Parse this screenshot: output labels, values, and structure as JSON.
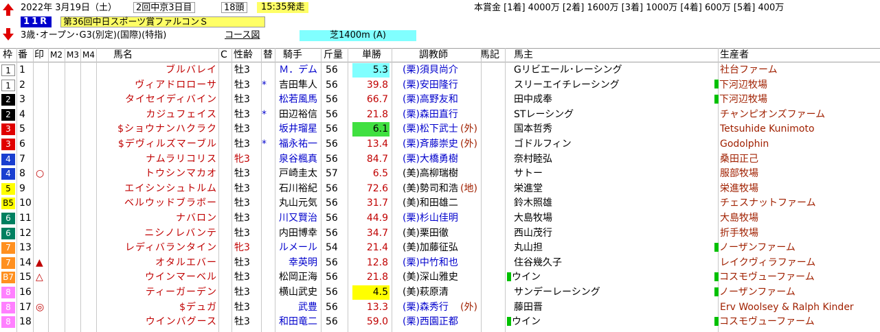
{
  "header": {
    "date": "2022年 3月19日（土）",
    "meeting": "2回中京3日目",
    "heads": "18頭",
    "post_time": "15:35発走",
    "prize": "本賞金 [1着] 4000万 [2着] 1600万 [3着] 1000万 [4着] 600万 [5着] 400万",
    "race_no": "11R",
    "race_name": "第36回中日スポーツ賞ファルコンＳ",
    "conditions": "3歳･オープン･G3(別定)(国際)(特指)",
    "course_link": "コース図",
    "course": "芝1400m (A)"
  },
  "columns": {
    "waku": "枠",
    "ban": "番",
    "mark": "印",
    "m2": "M2",
    "m3": "M3",
    "m4": "M4",
    "name": "馬名",
    "c": "C",
    "sexage": "性齢",
    "change": "替",
    "jockey": "騎手",
    "weight": "斤量",
    "odds": "単勝",
    "trainer": "調教師",
    "uma_ki": "馬記",
    "owner": "馬主",
    "breeder": "生産者"
  },
  "colors": {
    "jockey_blue": "#0000cc",
    "name_red": "#c00000",
    "breeder_brown": "#a02000"
  },
  "horses": [
    {
      "waku": "1",
      "ban": "1",
      "mark": "",
      "name": "ブルバレイ",
      "sexage": "牡3",
      "change": "",
      "jockey": "Ｍ．デム",
      "weight": "56",
      "odds": "5.3",
      "trainer": "(栗)須貝尚介",
      "owner": "Gリビエール･レーシング",
      "breeder": "社台ファーム"
    },
    {
      "waku": "1",
      "ban": "2",
      "mark": "",
      "name": "ヴィアドロローサ",
      "sexage": "牡3",
      "change": "*",
      "jockey": "吉田隼人",
      "weight": "56",
      "odds": "39.8",
      "trainer": "(栗)安田隆行",
      "owner": "スリーエイチレーシング",
      "breeder": "下河辺牧場"
    },
    {
      "waku": "2",
      "ban": "3",
      "mark": "",
      "name": "タイセイディバイン",
      "sexage": "牡3",
      "change": "",
      "jockey": "松若風馬",
      "weight": "56",
      "odds": "66.7",
      "trainer": "(栗)高野友和",
      "owner": "田中成奉",
      "breeder": "下河辺牧場"
    },
    {
      "waku": "2",
      "ban": "4",
      "mark": "",
      "name": "カジュフェイス",
      "sexage": "牡3",
      "change": "*",
      "jockey": "田辺裕信",
      "weight": "56",
      "odds": "21.8",
      "trainer": "(栗)森田直行",
      "owner": "STレーシング",
      "breeder": "チャンピオンズファーム"
    },
    {
      "waku": "3",
      "ban": "5",
      "mark": "",
      "name": "$ショウナンハクラク",
      "sexage": "牡3",
      "change": "",
      "jockey": "坂井瑠星",
      "weight": "56",
      "odds": "6.1",
      "trainer": "(栗)松下武士",
      "trainer_note": "(外)",
      "owner": "国本哲秀",
      "breeder": "Tetsuhide Kunimoto"
    },
    {
      "waku": "3",
      "ban": "6",
      "mark": "",
      "name": "$デヴィルズマーブル",
      "sexage": "牡3",
      "change": "*",
      "jockey": "福永祐一",
      "weight": "56",
      "odds": "13.4",
      "trainer": "(栗)斉藤崇史",
      "trainer_note": "(外)",
      "owner": "ゴドルフィン",
      "breeder": "Godolphin"
    },
    {
      "waku": "4",
      "ban": "7",
      "mark": "",
      "name": "ナムラリコリス",
      "sexage": "牝3",
      "change": "",
      "jockey": "泉谷楓真",
      "weight": "56",
      "odds": "84.7",
      "trainer": "(栗)大橋勇樹",
      "owner": "奈村睦弘",
      "breeder": "桑田正己"
    },
    {
      "waku": "4",
      "ban": "8",
      "mark": "○",
      "name": "トウシンマカオ",
      "sexage": "牡3",
      "change": "",
      "jockey": "戸崎圭太",
      "weight": "57",
      "odds": "6.5",
      "trainer": "(美)高柳瑞樹",
      "owner": "サトー",
      "breeder": "服部牧場"
    },
    {
      "waku": "5",
      "ban": "9",
      "mark": "",
      "name": "エイシンシュトルム",
      "sexage": "牡3",
      "change": "",
      "jockey": "石川裕紀",
      "weight": "56",
      "odds": "72.6",
      "trainer": "(美)勢司和浩",
      "trainer_note": "(地)",
      "owner": "栄進堂",
      "breeder": "栄進牧場"
    },
    {
      "waku": "B5",
      "ban": "10",
      "mark": "",
      "name": "ベルウッドブラボー",
      "sexage": "牡3",
      "change": "",
      "jockey": "丸山元気",
      "weight": "56",
      "odds": "31.7",
      "trainer": "(美)和田雄二",
      "owner": "鈴木照雄",
      "breeder": "チェスナットファーム"
    },
    {
      "waku": "6",
      "ban": "11",
      "mark": "",
      "name": "ナバロン",
      "sexage": "牡3",
      "change": "",
      "jockey": "川又賢治",
      "weight": "56",
      "odds": "44.9",
      "trainer": "(栗)杉山佳明",
      "owner": "大島牧場",
      "breeder": "大島牧場"
    },
    {
      "waku": "6",
      "ban": "12",
      "mark": "",
      "name": "ニシノレバンテ",
      "sexage": "牡3",
      "change": "",
      "jockey": "内田博幸",
      "weight": "56",
      "odds": "34.7",
      "trainer": "(美)栗田徹",
      "owner": "西山茂行",
      "breeder": "折手牧場"
    },
    {
      "waku": "7",
      "ban": "13",
      "mark": "",
      "name": "レディバランタイン",
      "sexage": "牝3",
      "change": "",
      "jockey": "ルメール",
      "weight": "54",
      "odds": "21.4",
      "trainer": "(美)加藤征弘",
      "owner": "丸山担",
      "breeder": "ノーザンファーム"
    },
    {
      "waku": "7",
      "ban": "14",
      "mark": "▲",
      "name": "オタルエバー",
      "sexage": "牡3",
      "change": "",
      "jockey": "幸英明",
      "weight": "56",
      "odds": "12.8",
      "trainer": "(栗)中竹和也",
      "owner": "住谷幾久子",
      "breeder": "レイクヴィラファーム"
    },
    {
      "waku": "B7",
      "ban": "15",
      "mark": "△",
      "name": "ウインマーベル",
      "sexage": "牡3",
      "change": "",
      "jockey": "松岡正海",
      "weight": "56",
      "odds": "21.8",
      "trainer": "(美)深山雅史",
      "owner": "ウイン",
      "breeder": "コスモヴューファーム"
    },
    {
      "waku": "8",
      "ban": "16",
      "mark": "",
      "name": "ティーガーデン",
      "sexage": "牡3",
      "change": "",
      "jockey": "横山武史",
      "weight": "56",
      "odds": "4.5",
      "trainer": "(美)萩原清",
      "owner": "サンデーレーシング",
      "breeder": "ノーザンファーム"
    },
    {
      "waku": "8",
      "ban": "17",
      "mark": "◎",
      "name": "$デュガ",
      "sexage": "牡3",
      "change": "",
      "jockey": "武豊",
      "weight": "56",
      "odds": "13.3",
      "trainer": "(栗)森秀行",
      "trainer_note": "(外)",
      "owner": "藤田晋",
      "breeder": "Erv Woolsey & Ralph Kinder"
    },
    {
      "waku": "8",
      "ban": "18",
      "mark": "",
      "name": "ウインバグース",
      "sexage": "牡3",
      "change": "",
      "jockey": "和田竜二",
      "weight": "56",
      "odds": "59.0",
      "trainer": "(栗)西園正都",
      "owner": "ウイン",
      "breeder": "コスモヴューファーム"
    }
  ]
}
